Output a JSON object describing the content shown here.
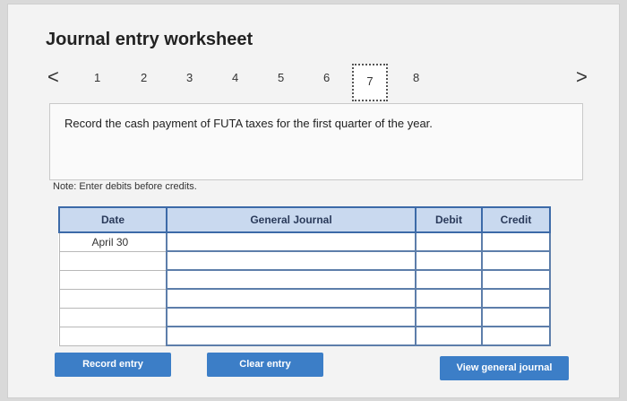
{
  "page": {
    "title": "Journal entry worksheet"
  },
  "nav": {
    "prev_arrow": "<",
    "next_arrow": ">",
    "steps": [
      "1",
      "2",
      "3",
      "4",
      "5",
      "6",
      "7",
      "8"
    ],
    "active_step": "7"
  },
  "prompt": {
    "text": "Record the cash payment of FUTA taxes for the first quarter of the year."
  },
  "note": "Note: Enter debits before credits.",
  "journal": {
    "headers": {
      "date": "Date",
      "general_journal": "General Journal",
      "debit": "Debit",
      "credit": "Credit"
    },
    "rows": [
      {
        "date": "April 30",
        "account": "",
        "debit": "",
        "credit": ""
      },
      {
        "date": "",
        "account": "",
        "debit": "",
        "credit": ""
      },
      {
        "date": "",
        "account": "",
        "debit": "",
        "credit": ""
      },
      {
        "date": "",
        "account": "",
        "debit": "",
        "credit": ""
      },
      {
        "date": "",
        "account": "",
        "debit": "",
        "credit": ""
      },
      {
        "date": "",
        "account": "",
        "debit": "",
        "credit": ""
      }
    ]
  },
  "buttons": {
    "record": "Record entry",
    "clear": "Clear entry",
    "view": "View general journal"
  },
  "colors": {
    "button_bg": "#3c7ec7",
    "header_bg": "#c9d9ef",
    "table_border": "#3c6aa8"
  }
}
